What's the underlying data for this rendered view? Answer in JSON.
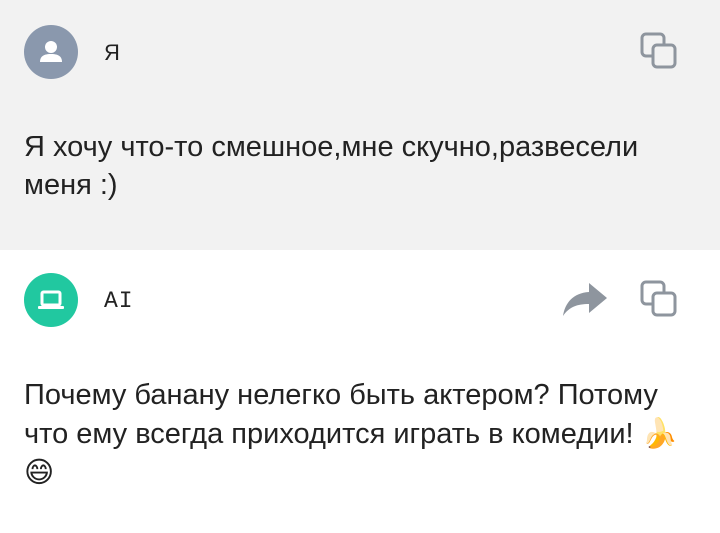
{
  "messages": {
    "user": {
      "author": "Я",
      "text": "Я хочу что-то смешное,мне скучно,развесели меня :)",
      "avatar_color": "#8a98ad",
      "background": "#f2f2f2"
    },
    "ai": {
      "author": "AI",
      "text": "Почему банану нелегко быть актером? Потому что ему всегда приходится играть в комедии!",
      "emoji_1": "🍌",
      "emoji_2": "😄",
      "avatar_color": "#21c8a0",
      "background": "#ffffff"
    }
  },
  "icons": {
    "user_avatar": "person-icon",
    "ai_avatar": "laptop-icon",
    "copy": "copy-icon",
    "share": "share-arrow-icon"
  },
  "colors": {
    "icon_gray": "#8e959e",
    "text": "#222222"
  }
}
